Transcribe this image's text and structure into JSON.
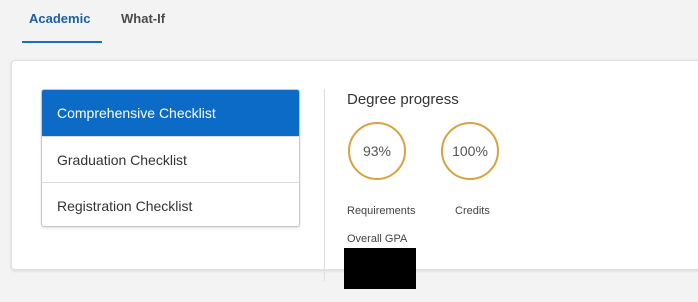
{
  "tabs": [
    {
      "label": "Academic",
      "active": true
    },
    {
      "label": "What-If",
      "active": false
    }
  ],
  "checklists": [
    {
      "label": "Comprehensive Checklist",
      "active": true
    },
    {
      "label": "Graduation Checklist",
      "active": false
    },
    {
      "label": "Registration Checklist",
      "active": false
    }
  ],
  "degree_progress": {
    "title": "Degree progress",
    "requirements": {
      "value": "93%",
      "label": "Requirements"
    },
    "credits": {
      "value": "100%",
      "label": "Credits"
    },
    "gpa_label": "Overall GPA"
  },
  "colors": {
    "accent": "#0b6bc7",
    "ring": "#d8a23f",
    "tab_active": "#1a5fa6"
  }
}
